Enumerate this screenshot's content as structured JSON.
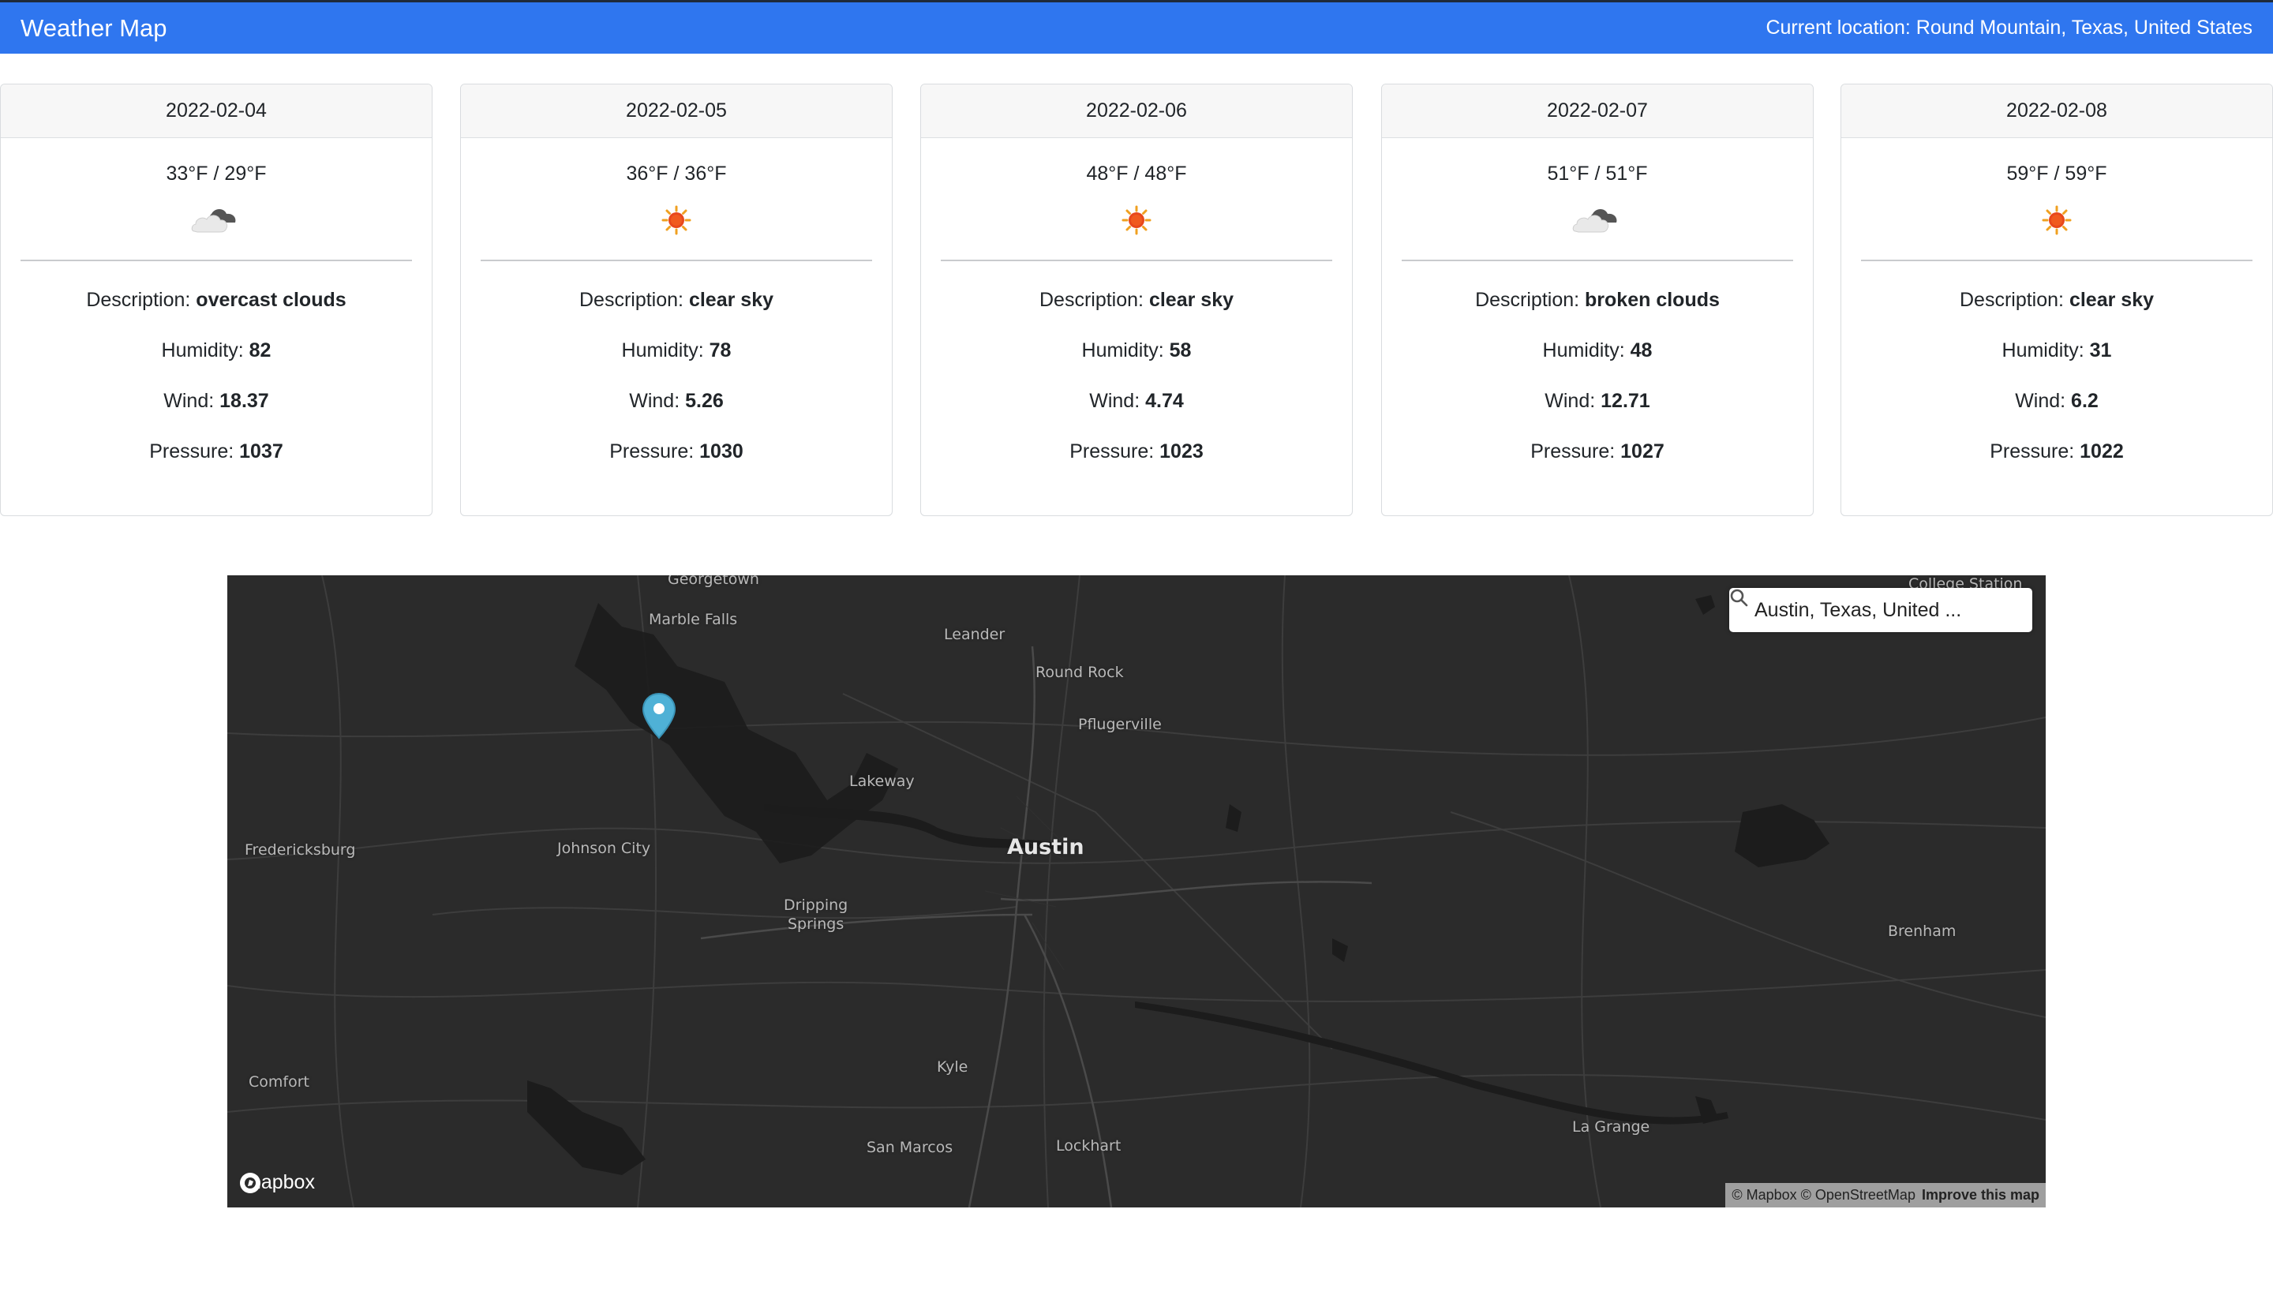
{
  "navbar": {
    "brand": "Weather Map",
    "location_text": "Current location: Round Mountain, Texas, United States",
    "color": "#2f76ef"
  },
  "forecast": [
    {
      "date": "2022-02-04",
      "temps": "33°F / 29°F",
      "icon": "cloud-icon",
      "description": "overcast clouds",
      "humidity": "82",
      "wind": "18.37",
      "pressure": "1037"
    },
    {
      "date": "2022-02-05",
      "temps": "36°F / 36°F",
      "icon": "sun-icon",
      "description": "clear sky",
      "humidity": "78",
      "wind": "5.26",
      "pressure": "1030"
    },
    {
      "date": "2022-02-06",
      "temps": "48°F / 48°F",
      "icon": "sun-icon",
      "description": "clear sky",
      "humidity": "58",
      "wind": "4.74",
      "pressure": "1023"
    },
    {
      "date": "2022-02-07",
      "temps": "51°F / 51°F",
      "icon": "cloud-icon",
      "description": "broken clouds",
      "humidity": "48",
      "wind": "12.71",
      "pressure": "1027"
    },
    {
      "date": "2022-02-08",
      "temps": "59°F / 59°F",
      "icon": "sun-icon",
      "description": "clear sky",
      "humidity": "31",
      "wind": "6.2",
      "pressure": "1022"
    }
  ],
  "labels": {
    "description": "Description:",
    "humidity": "Humidity:",
    "wind": "Wind:",
    "pressure": "Pressure:"
  },
  "map": {
    "search_value": "Austin, Texas, United ...",
    "places": [
      "Georgetown",
      "College Station",
      "Marble Falls",
      "Leander",
      "Round Rock",
      "Pflugerville",
      "Lakeway",
      "Austin",
      "Fredericksburg",
      "Johnson City",
      "Dripping",
      "Springs",
      "Brenham",
      "Kyle",
      "Comfort",
      "La Grange",
      "San Marcos",
      "Lockhart"
    ],
    "logo_text": "mapbox",
    "attribution": "© Mapbox © OpenStreetMap",
    "improve_link": "Improve this map",
    "marker_color": "#4fb1d6"
  }
}
